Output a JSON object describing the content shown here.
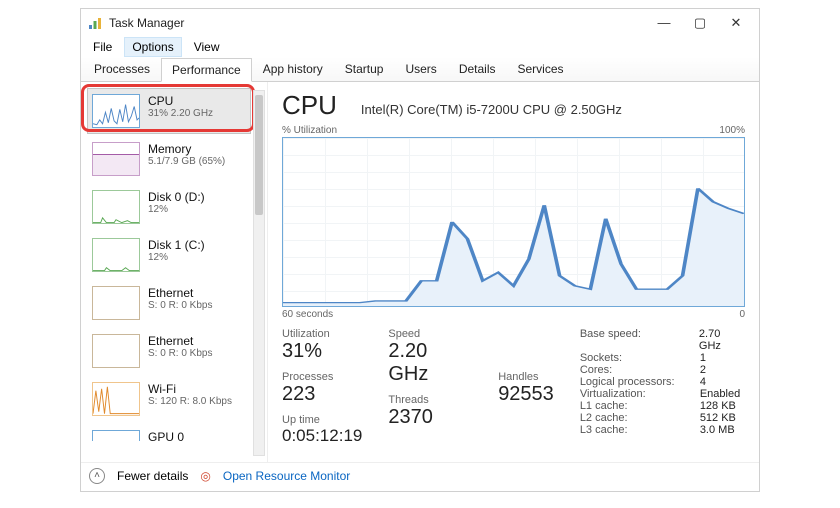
{
  "window": {
    "title": "Task Manager"
  },
  "menu": {
    "file": "File",
    "options": "Options",
    "view": "View"
  },
  "tabs": {
    "processes": "Processes",
    "performance": "Performance",
    "app_history": "App history",
    "startup": "Startup",
    "users": "Users",
    "details": "Details",
    "services": "Services"
  },
  "sidebar": [
    {
      "label": "CPU",
      "sub": "31% 2.20 GHz",
      "color": "#4e86c6",
      "icon": "cpu"
    },
    {
      "label": "Memory",
      "sub": "5.1/7.9 GB (65%)",
      "color": "#a45ba7",
      "icon": "memory"
    },
    {
      "label": "Disk 0 (D:)",
      "sub": "12%",
      "color": "#5aa854",
      "icon": "disk"
    },
    {
      "label": "Disk 1 (C:)",
      "sub": "12%",
      "color": "#5aa854",
      "icon": "disk"
    },
    {
      "label": "Ethernet",
      "sub": "S: 0 R: 0 Kbps",
      "color": "#a07846",
      "icon": "eth"
    },
    {
      "label": "Ethernet",
      "sub": "S: 0 R: 0 Kbps",
      "color": "#a07846",
      "icon": "eth"
    },
    {
      "label": "Wi-Fi",
      "sub": "S: 120 R: 8.0 Kbps",
      "color": "#e08a2c",
      "icon": "wifi"
    },
    {
      "label": "GPU 0",
      "sub": "",
      "color": "#4e86c6",
      "icon": "gpu"
    }
  ],
  "pane": {
    "name": "CPU",
    "processor": "Intel(R) Core(TM) i5-7200U CPU @ 2.50GHz",
    "axis_top_left": "% Utilization",
    "axis_top_right": "100%",
    "axis_bot_left": "60 seconds",
    "axis_bot_right": "0",
    "stats": {
      "utilization_label": "Utilization",
      "utilization": "31%",
      "speed_label": "Speed",
      "speed": "2.20 GHz",
      "processes_label": "Processes",
      "processes": "223",
      "threads_label": "Threads",
      "threads": "2370",
      "handles_label": "Handles",
      "handles": "92553",
      "uptime_label": "Up time",
      "uptime": "0:05:12:19"
    },
    "specs": {
      "base_speed_k": "Base speed:",
      "base_speed_v": "2.70 GHz",
      "sockets_k": "Sockets:",
      "sockets_v": "1",
      "cores_k": "Cores:",
      "cores_v": "2",
      "logical_k": "Logical processors:",
      "logical_v": "4",
      "virt_k": "Virtualization:",
      "virt_v": "Enabled",
      "l1_k": "L1 cache:",
      "l1_v": "128 KB",
      "l2_k": "L2 cache:",
      "l2_v": "512 KB",
      "l3_k": "L3 cache:",
      "l3_v": "3.0 MB"
    }
  },
  "footer": {
    "fewer": "Fewer details",
    "open_resmon": "Open Resource Monitor"
  },
  "chart_data": {
    "type": "line",
    "title": "CPU % Utilization over last 60 seconds",
    "xlabel": "seconds ago (60 → 0)",
    "ylabel": "% Utilization",
    "ylim": [
      0,
      100
    ],
    "xlim": [
      60,
      0
    ],
    "x": [
      60,
      58,
      56,
      54,
      52,
      50,
      48,
      46,
      44,
      42,
      40,
      38,
      36,
      34,
      32,
      30,
      28,
      26,
      24,
      22,
      20,
      18,
      16,
      14,
      12,
      10,
      8,
      6,
      4,
      2,
      0
    ],
    "values": [
      2,
      2,
      2,
      2,
      2,
      2,
      3,
      3,
      3,
      15,
      15,
      50,
      40,
      15,
      20,
      12,
      28,
      60,
      18,
      12,
      10,
      52,
      25,
      10,
      10,
      10,
      18,
      70,
      62,
      58,
      55
    ]
  }
}
